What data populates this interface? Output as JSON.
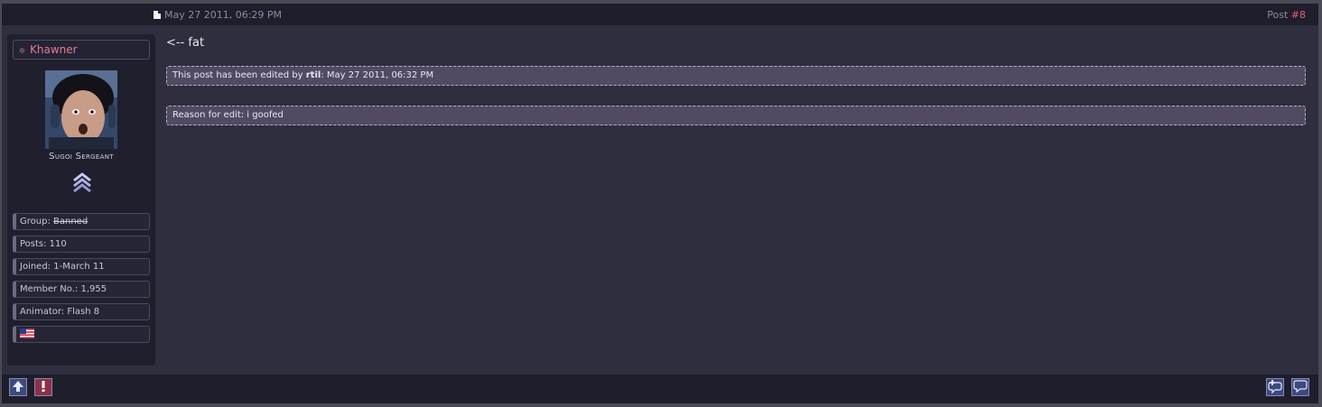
{
  "post": {
    "date": "May 27 2011, 06:29 PM",
    "number_label": "Post",
    "number": "#8",
    "body": "<-- fat"
  },
  "user": {
    "name": "Khawner",
    "rank_title": "Sugoi Sergeant",
    "group_label": "Group:",
    "group_value": "Banned",
    "posts": "Posts: 110",
    "joined": "Joined: 1-March 11",
    "member_no": "Member No.: 1,955",
    "custom_field": "Animator: Flash 8",
    "country_flag": "us-flag-icon"
  },
  "edit": {
    "prefix": "This post has been edited by",
    "editor": "rtil",
    "date": ": May 27 2011, 06:32 PM",
    "reason": "Reason for edit: i goofed"
  },
  "colors": {
    "accent": "#e0607a",
    "username": "#e87a8e",
    "background": "#2e2e3e",
    "panel": "#1f1f2e",
    "edit_box": "#524a62"
  },
  "icons": {
    "top": "arrow-up-icon",
    "report": "report-icon",
    "multiquote": "multiquote-icon",
    "quote": "quote-icon"
  }
}
